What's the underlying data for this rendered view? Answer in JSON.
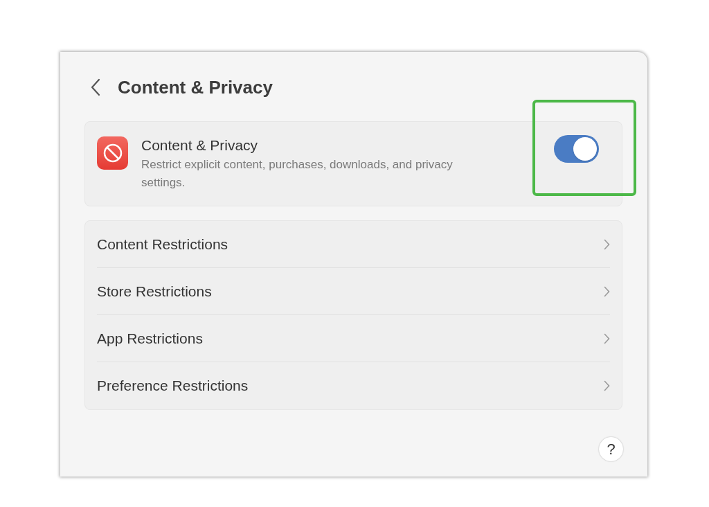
{
  "header": {
    "title": "Content & Privacy"
  },
  "main_setting": {
    "title": "Content & Privacy",
    "description": "Restrict explicit content, purchases, downloads, and privacy settings.",
    "on": true
  },
  "restrictions": [
    {
      "label": "Content Restrictions"
    },
    {
      "label": "Store Restrictions"
    },
    {
      "label": "App Restrictions"
    },
    {
      "label": "Preference Restrictions"
    }
  ],
  "help": {
    "label": "?"
  }
}
